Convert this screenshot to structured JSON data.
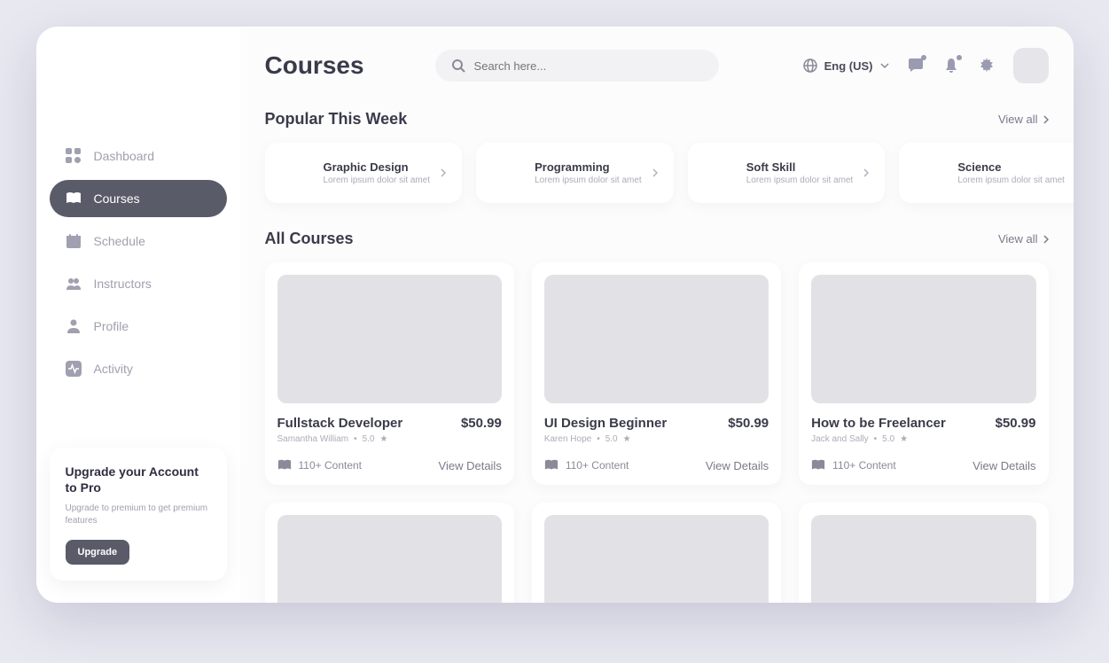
{
  "page_title": "Courses",
  "search": {
    "placeholder": "Search here..."
  },
  "language": "Eng (US)",
  "sidebar": {
    "items": [
      {
        "label": "Dashboard"
      },
      {
        "label": "Courses"
      },
      {
        "label": "Schedule"
      },
      {
        "label": "Instructors"
      },
      {
        "label": "Profile"
      },
      {
        "label": "Activity"
      }
    ]
  },
  "upgrade": {
    "title": "Upgrade your Account to Pro",
    "subtitle": "Upgrade to premium to get premium features",
    "button": "Upgrade"
  },
  "popular": {
    "heading": "Popular This Week",
    "view_all": "View all",
    "items": [
      {
        "title": "Graphic Design",
        "sub": "Lorem ipsum dolor sit amet"
      },
      {
        "title": "Programming",
        "sub": "Lorem ipsum dolor sit amet"
      },
      {
        "title": "Soft Skill",
        "sub": "Lorem ipsum dolor sit amet"
      },
      {
        "title": "Science",
        "sub": "Lorem ipsum dolor sit amet"
      }
    ]
  },
  "all_courses": {
    "heading": "All Courses",
    "view_all": "View all",
    "view_details": "View Details",
    "content_label": "110+ Content",
    "items": [
      {
        "title": "Fullstack Developer",
        "author": "Samantha William",
        "rating": "5.0",
        "price": "$50.99"
      },
      {
        "title": "UI Design Beginner",
        "author": "Karen Hope",
        "rating": "5.0",
        "price": "$50.99"
      },
      {
        "title": "How to be Freelancer",
        "author": "Jack and Sally",
        "rating": "5.0",
        "price": "$50.99"
      }
    ]
  }
}
